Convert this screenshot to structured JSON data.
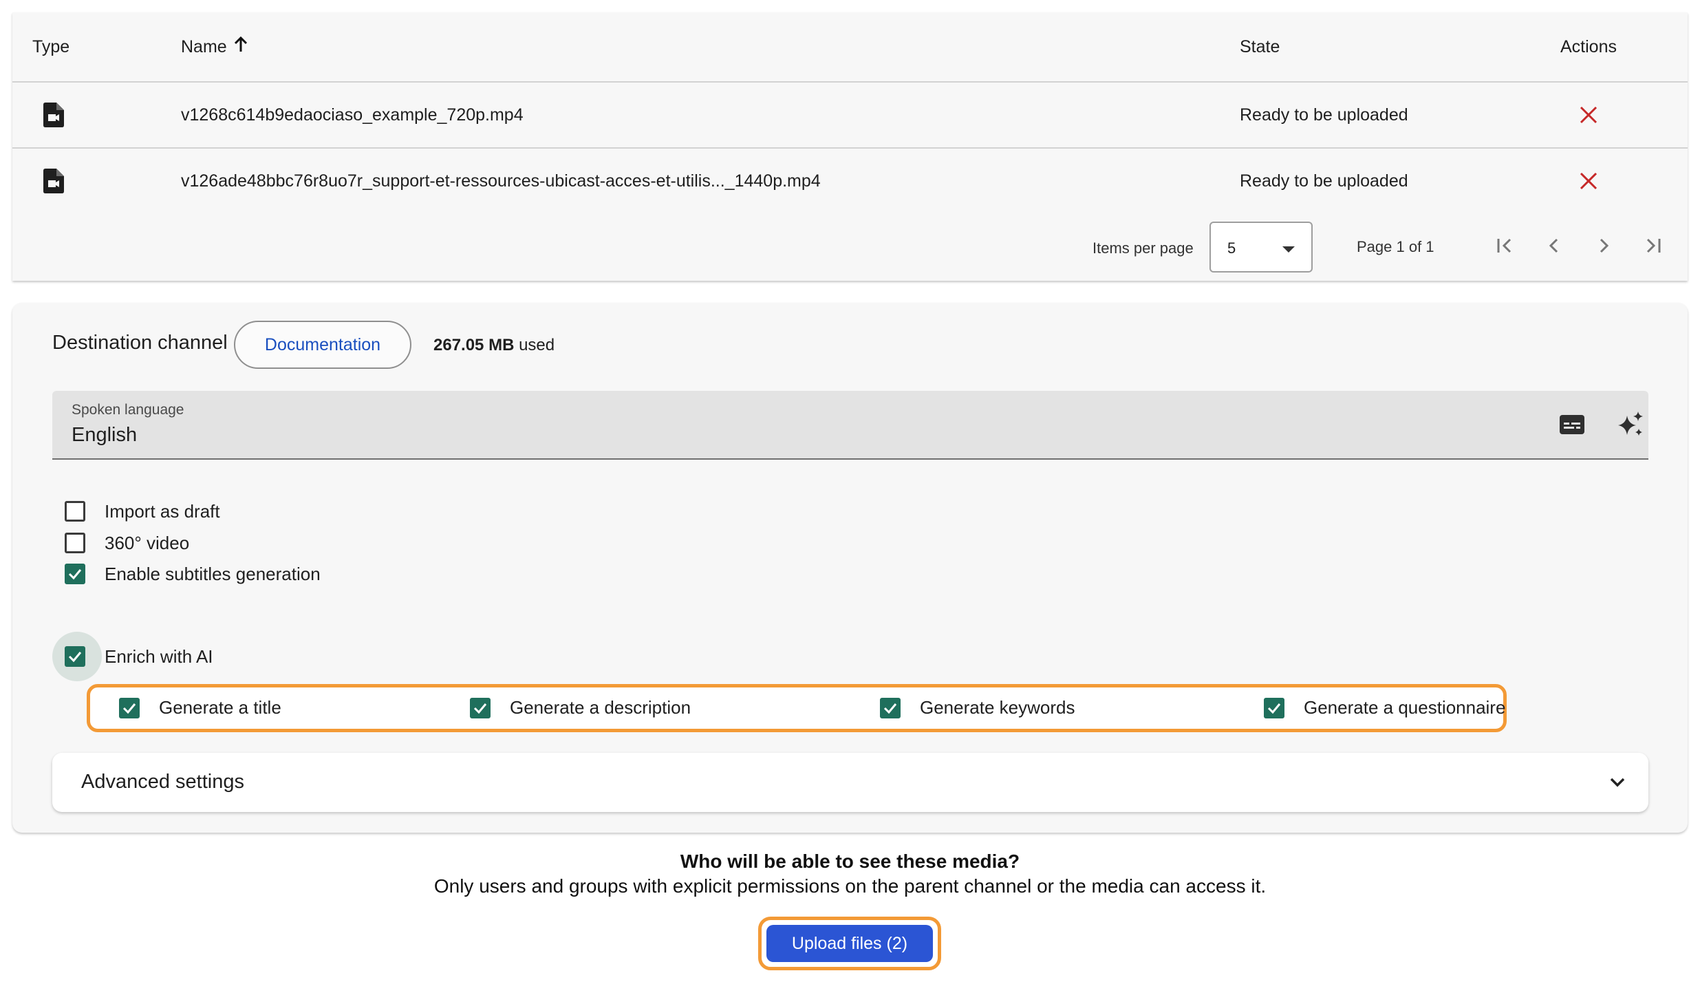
{
  "table": {
    "headers": {
      "type": "Type",
      "name": "Name",
      "state": "State",
      "actions": "Actions"
    },
    "sort_icon": "arrow-up-icon",
    "rows": [
      {
        "type_icon": "video-file-icon",
        "name": "v1268c614b9edaociaso_example_720p.mp4",
        "state": "Ready to be uploaded",
        "action_icon": "close-icon"
      },
      {
        "type_icon": "video-file-icon",
        "name": "v126ade48bbc76r8uo7r_support-et-ressources-ubicast-acces-et-utilis..._1440p.mp4",
        "state": "Ready to be uploaded",
        "action_icon": "close-icon"
      }
    ],
    "paginator": {
      "items_per_page_label": "Items per page",
      "items_per_page_value": "5",
      "range_label": "Page 1 of 1"
    }
  },
  "settings": {
    "destination_label": "Destination channel",
    "channel_chip": "Documentation",
    "usage_amount": "267.05 MB",
    "usage_suffix": "used",
    "spoken_language": {
      "label": "Spoken language",
      "value": "English"
    },
    "options": [
      {
        "label": "Import as draft",
        "checked": false
      },
      {
        "label": "360° video",
        "checked": false
      },
      {
        "label": "Enable subtitles generation",
        "checked": true
      },
      {
        "label": "Enrich with AI",
        "checked": true
      }
    ],
    "ai_options": [
      {
        "label": "Generate a title",
        "checked": true
      },
      {
        "label": "Generate a description",
        "checked": true
      },
      {
        "label": "Generate keywords",
        "checked": true
      },
      {
        "label": "Generate a questionnaire",
        "checked": true
      }
    ],
    "advanced_label": "Advanced settings"
  },
  "visibility": {
    "title": "Who will be able to see these media?",
    "text": "Only users and groups with explicit permissions on the parent channel or the media can access it."
  },
  "upload_button": "Upload files (2)",
  "colors": {
    "accent": "#2b55d4",
    "checkbox": "#1f6f5c",
    "highlight": "#f39a36",
    "danger": "#c62828"
  }
}
